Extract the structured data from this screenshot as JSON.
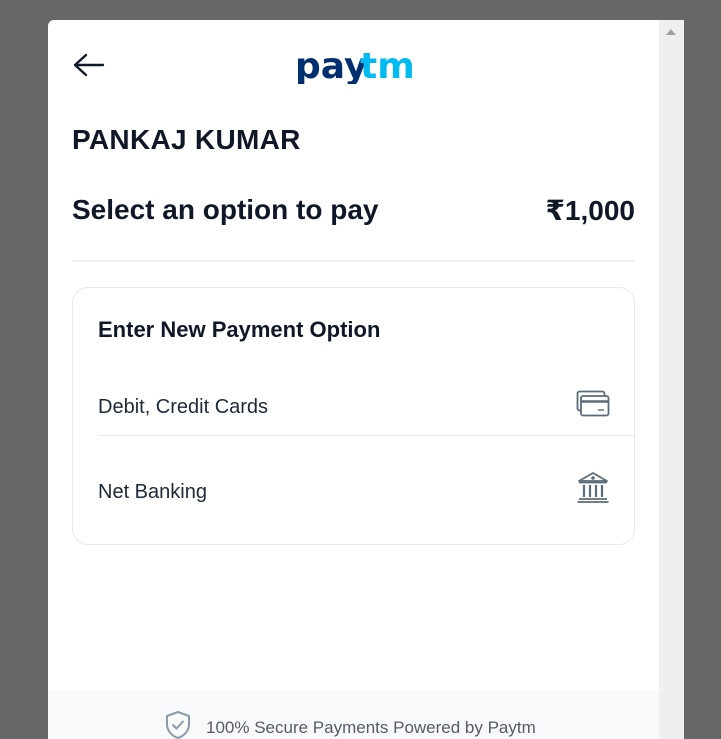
{
  "header": {
    "back_icon": "arrow-left-icon",
    "logo_text_1": "pay",
    "logo_text_2": "tm",
    "logo_colors": {
      "dark": "#002e6e",
      "light": "#00baf2"
    }
  },
  "merchant_name": "PANKAJ KUMAR",
  "payment": {
    "title": "Select an option to pay",
    "amount": "₹1,000"
  },
  "new_payment": {
    "title": "Enter New Payment Option",
    "options": [
      {
        "label": "Debit, Credit Cards",
        "icon": "credit-card-icon"
      },
      {
        "label": "Net Banking",
        "icon": "bank-icon"
      }
    ]
  },
  "footer": {
    "text": "100% Secure Payments Powered by Paytm",
    "icon": "shield-check-icon"
  },
  "colors": {
    "overlay": "#666766",
    "text_primary": "#101828",
    "icon_slate": "#5b6b7b"
  }
}
